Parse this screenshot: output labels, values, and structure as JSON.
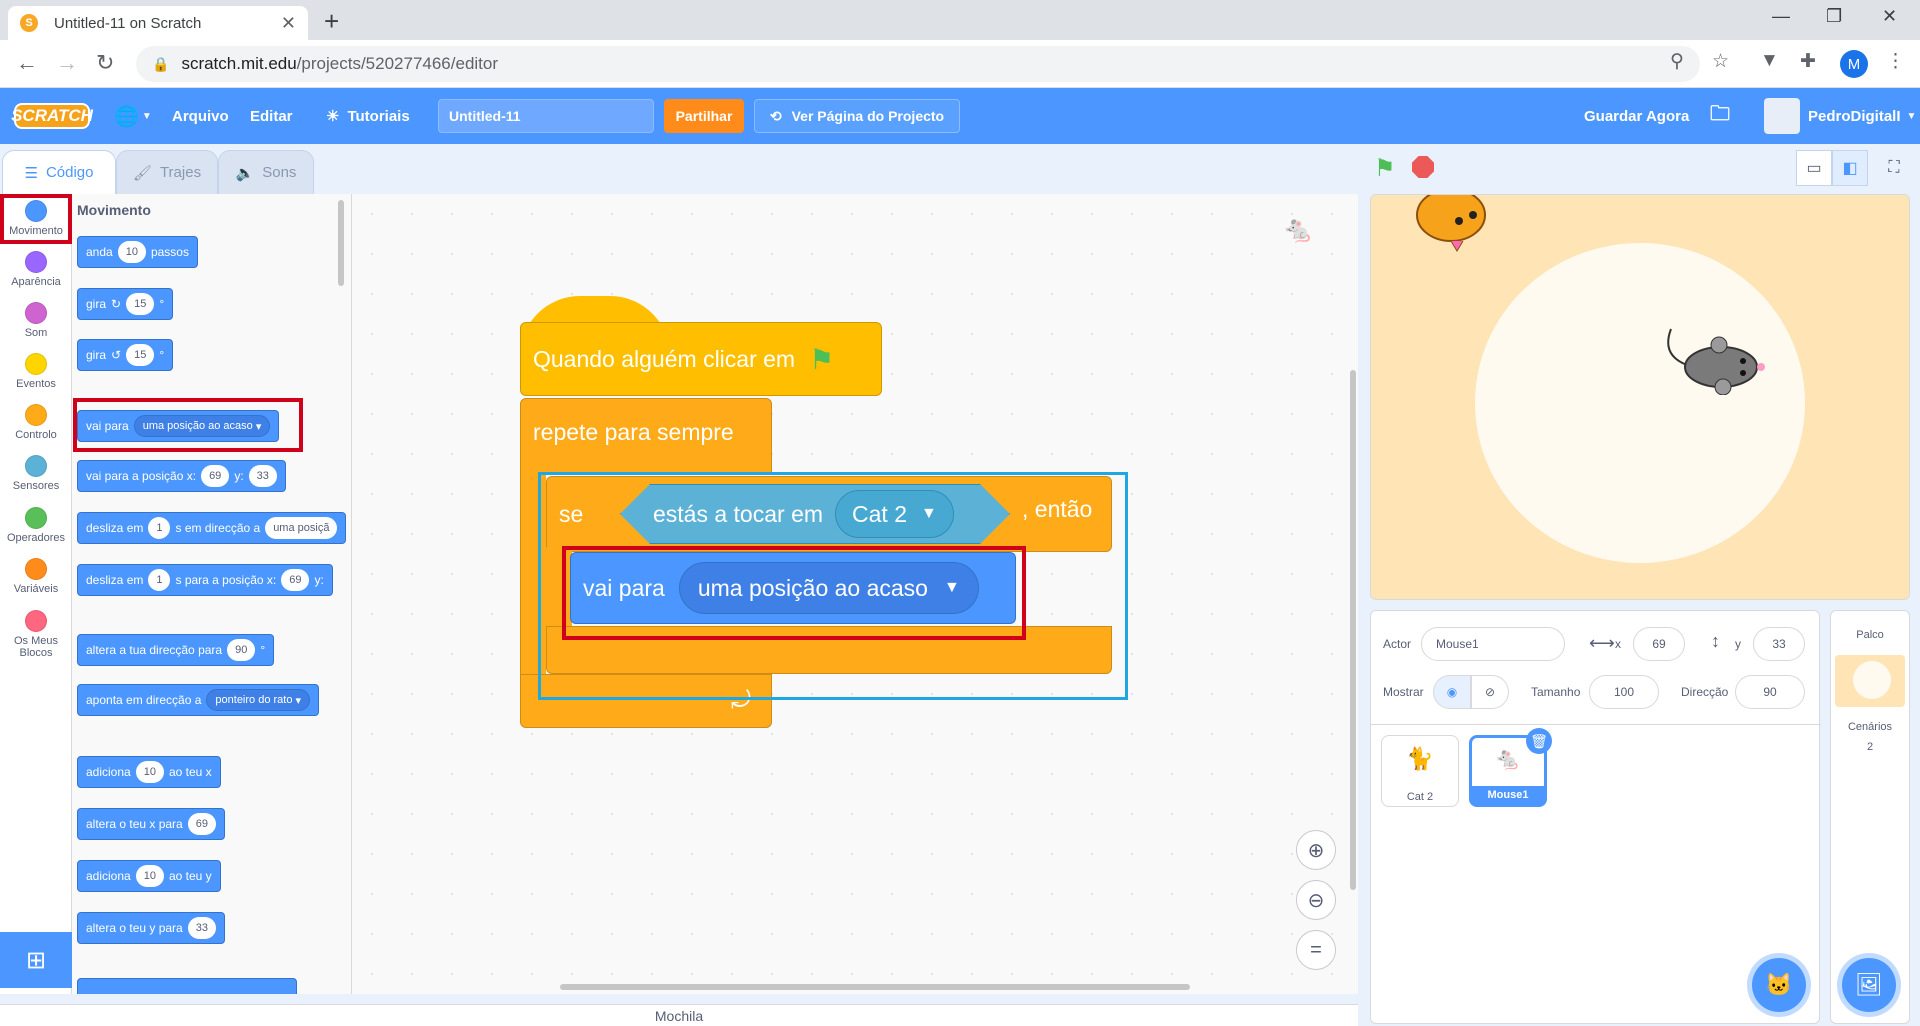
{
  "browser": {
    "tab_title": "Untitled-11 on Scratch",
    "url_host": "scratch.mit.edu",
    "url_path": "/projects/520277466/editor",
    "profile_initial": "M"
  },
  "menu": {
    "logo": "SCRATCH",
    "file": "Arquivo",
    "edit": "Editar",
    "tutorials": "Tutoriais",
    "project_title": "Untitled-11",
    "share": "Partilhar",
    "see_project_page": "Ver Página do Projecto",
    "save_now": "Guardar Agora",
    "username": "PedroDigitalI"
  },
  "tabs": {
    "code": "Código",
    "costumes": "Trajes",
    "sounds": "Sons"
  },
  "categories": [
    {
      "label": "Movimento",
      "color": "#4c97ff"
    },
    {
      "label": "Aparência",
      "color": "#9966ff"
    },
    {
      "label": "Som",
      "color": "#cf63cf"
    },
    {
      "label": "Eventos",
      "color": "#ffd500"
    },
    {
      "label": "Controlo",
      "color": "#ffab19"
    },
    {
      "label": "Sensores",
      "color": "#5cb1d6"
    },
    {
      "label": "Operadores",
      "color": "#59c059"
    },
    {
      "label": "Variáveis",
      "color": "#ff8c1a"
    },
    {
      "label": "Os Meus Blocos",
      "color": "#ff6680"
    }
  ],
  "palette": {
    "title": "Movimento",
    "move": {
      "a": "anda",
      "n": "10",
      "b": "passos"
    },
    "turn_right": {
      "a": "gira",
      "n": "15",
      "deg": "°"
    },
    "turn_left": {
      "a": "gira",
      "n": "15",
      "deg": "°"
    },
    "goto": {
      "a": "vai para",
      "drop": "uma posição ao acaso"
    },
    "goto_xy": {
      "a": "vai para a posição x:",
      "x": "69",
      "b": "y:",
      "y": "33"
    },
    "glide_to": {
      "a": "desliza em",
      "n": "1",
      "b": "s em direcção a",
      "drop": "uma posiçã"
    },
    "glide_xy": {
      "a": "desliza em",
      "n": "1",
      "b": "s para a posição x:",
      "x": "69",
      "c": "y:"
    },
    "point_dir": {
      "a": "altera a tua direcção para",
      "n": "90",
      "deg": "°"
    },
    "point_towards": {
      "a": "aponta em direcção a",
      "drop": "ponteiro do rato"
    },
    "change_x": {
      "a": "adiciona",
      "n": "10",
      "b": "ao teu x"
    },
    "set_x": {
      "a": "altera o teu x para",
      "n": "69"
    },
    "change_y": {
      "a": "adiciona",
      "n": "10",
      "b": "ao teu y"
    },
    "set_y": {
      "a": "altera o teu y para",
      "n": "33"
    }
  },
  "script": {
    "hat": "Quando alguém clicar em",
    "forever": "repete para sempre",
    "if": "se",
    "sensing": "estás a tocar em",
    "sensing_drop": "Cat 2",
    "then": ", então",
    "goto": "vai para",
    "goto_drop": "uma posição ao acaso"
  },
  "backpack": "Mochila",
  "sprite_info": {
    "actor_label": "Actor",
    "actor_name": "Mouse1",
    "x_label": "x",
    "x": "69",
    "y_label": "y",
    "y": "33",
    "show_label": "Mostrar",
    "size_label": "Tamanho",
    "size": "100",
    "direction_label": "Direcção",
    "direction": "90"
  },
  "sprites": [
    {
      "name": "Cat 2",
      "selected": false
    },
    {
      "name": "Mouse1",
      "selected": true
    }
  ],
  "stage_panel": {
    "title": "Palco",
    "backdrops_label": "Cenários",
    "backdrops_count": "2"
  },
  "colors": {
    "scratch_blue": "#4c97ff",
    "highlight_red": "#d0021b",
    "highlight_blue": "#1ea7e1"
  }
}
